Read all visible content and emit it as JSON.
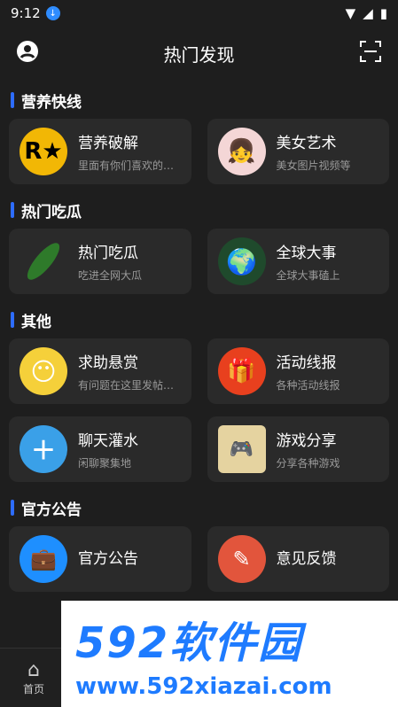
{
  "status": {
    "time": "9:12"
  },
  "header": {
    "title": "热门发现"
  },
  "sections": [
    {
      "title": "营养快线",
      "items": [
        {
          "name": "营养破解",
          "desc": "里面有你们喜欢的…",
          "icon": "rockstar-logo-icon",
          "color": "#f2b705"
        },
        {
          "name": "美女艺术",
          "desc": "美女图片视频等",
          "icon": "girl-avatar-icon",
          "color": "#f4d6d6"
        }
      ]
    },
    {
      "title": "热门吃瓜",
      "items": [
        {
          "name": "热门吃瓜",
          "desc": "吃进全网大瓜",
          "icon": "cucumber-icon",
          "color": "#2e5a1c"
        },
        {
          "name": "全球大事",
          "desc": "全球大事磕上",
          "icon": "globe-icon",
          "color": "#1f4a2c"
        }
      ]
    },
    {
      "title": "其他",
      "items": [
        {
          "name": "求助悬赏",
          "desc": "有问题在这里发帖…",
          "icon": "emoji-question-icon",
          "color": "#f5d03a"
        },
        {
          "name": "活动线报",
          "desc": "各种活动线报",
          "icon": "gift-icon",
          "color": "#e8401e"
        },
        {
          "name": "聊天灌水",
          "desc": "闲聊聚集地",
          "icon": "chat-bubble-icon",
          "color": "#3aa0e8"
        },
        {
          "name": "游戏分享",
          "desc": "分享各种游戏",
          "icon": "game-screen-icon",
          "color": "#e5d3a0"
        }
      ]
    },
    {
      "title": "官方公告",
      "items": [
        {
          "name": "官方公告",
          "desc": "",
          "icon": "briefcase-icon",
          "color": "#1e8fff"
        },
        {
          "name": "意见反馈",
          "desc": "",
          "icon": "feedback-icon",
          "color": "#e2553c"
        }
      ]
    }
  ],
  "nav": {
    "home": "首页"
  },
  "watermark": {
    "brand": "592软件园",
    "url": "www.592xiazai.com"
  }
}
